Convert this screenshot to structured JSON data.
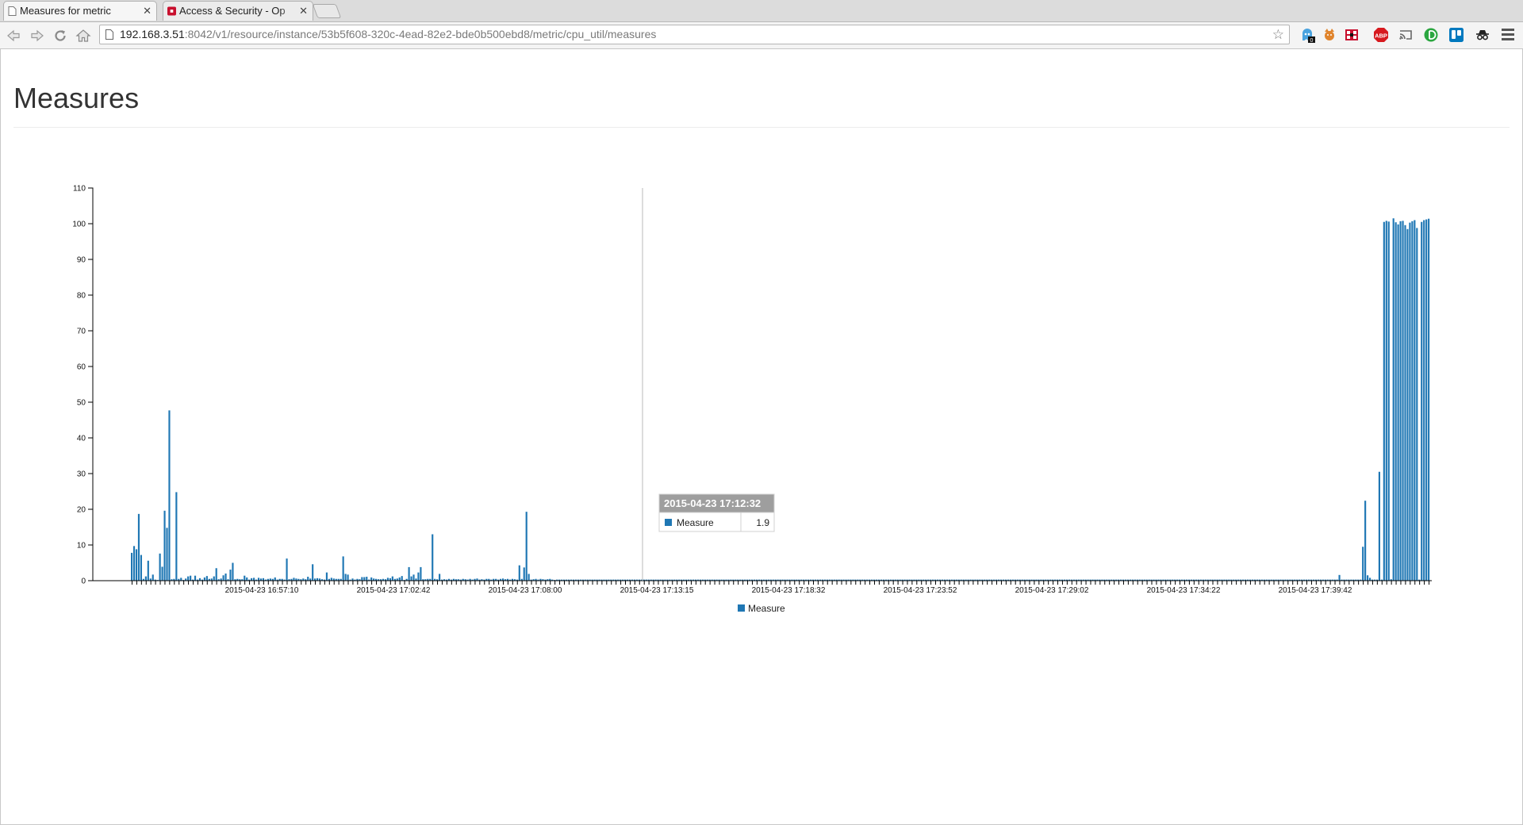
{
  "browser": {
    "tabs": [
      {
        "title": "Measures for metric",
        "active": true,
        "icon": "page-icon"
      },
      {
        "title": "Access & Security - Op",
        "active": false,
        "icon": "openstack-icon"
      }
    ],
    "url_host": "192.168.3.51",
    "url_rest": ":8042/v1/resource/instance/53b5f608-320c-4ead-82e2-bde0b500ebd8/metric/cpu_util/measures",
    "extensions": [
      "ghostery-icon",
      "fox-icon",
      "shield-icon",
      "adblock-plus-icon",
      "cast-icon",
      "ios-icon",
      "trello-icon",
      "incognito-icon"
    ],
    "ghostery_badge": "0",
    "abp_label": "ABP"
  },
  "page": {
    "title": "Measures"
  },
  "tooltip": {
    "time": "2015-04-23 17:12:32",
    "series": "Measure",
    "value": "1.9"
  },
  "chart_data": {
    "type": "bar",
    "title": "",
    "xlabel": "",
    "ylabel": "",
    "ylim": [
      0,
      110
    ],
    "yticks": [
      0,
      10,
      20,
      30,
      40,
      50,
      60,
      70,
      80,
      90,
      100,
      110
    ],
    "x_tick_labels": [
      "2015-04-23 16:57:10",
      "2015-04-23 17:02:42",
      "2015-04-23 17:08:00",
      "2015-04-23 17:13:15",
      "2015-04-23 17:18:32",
      "2015-04-23 17:23:52",
      "2015-04-23 17:29:02",
      "2015-04-23 17:34:22",
      "2015-04-23 17:39:42"
    ],
    "legend": [
      "Measure"
    ],
    "legend_position": "bottom",
    "bar_color": "#1f77b4",
    "series": [
      {
        "name": "Measure",
        "values": [
          7.8,
          9.7,
          8.8,
          18.7,
          7.2,
          0.5,
          1.2,
          5.6,
          0.6,
          1.7,
          0.3,
          0.2,
          7.6,
          3.9,
          19.6,
          14.8,
          47.7,
          0.4,
          0.5,
          24.8,
          0.5,
          0.8,
          0.2,
          0.6,
          1.2,
          1.4,
          0.3,
          1.4,
          0.3,
          0.7,
          0.3,
          0.9,
          1.3,
          0.5,
          0.6,
          1.2,
          3.5,
          0.4,
          0.6,
          1.5,
          2.0,
          0.4,
          3.1,
          5.0,
          0.4,
          0.5,
          0.4,
          0.4,
          1.4,
          0.9,
          0.3,
          0.7,
          0.8,
          0.3,
          0.8,
          0.6,
          0.7,
          0.3,
          0.5,
          0.6,
          0.5,
          0.9,
          0.3,
          0.5,
          0.5,
          0.3,
          6.2,
          0.4,
          0.5,
          0.8,
          0.6,
          0.5,
          0.4,
          0.6,
          0.4,
          1.1,
          0.6,
          4.6,
          0.6,
          0.7,
          0.6,
          0.4,
          0.3,
          2.3,
          0.5,
          0.8,
          0.6,
          0.5,
          0.5,
          0.5,
          6.8,
          1.9,
          1.7,
          0.3,
          0.6,
          0.3,
          0.5,
          0.4,
          1.0,
          1.0,
          1.1,
          0.3,
          0.9,
          0.6,
          0.5,
          0.4,
          0.4,
          0.5,
          0.4,
          0.8,
          0.7,
          1.2,
          0.5,
          0.6,
          0.9,
          1.3,
          0.2,
          0.5,
          3.8,
          1.2,
          1.7,
          0.6,
          2.3,
          3.8,
          0.4,
          0.4,
          0.5,
          0.5,
          13.0,
          0.5,
          0.4,
          1.9,
          0.3,
          0.4,
          0.3,
          0.5,
          0.3,
          0.5,
          0.4,
          0.4,
          0.3,
          0.5,
          0.4,
          0.3,
          0.5,
          0.3,
          0.5,
          0.6,
          0.3,
          0.4,
          0.3,
          0.5,
          0.5,
          0.3,
          0.5,
          0.5,
          0.3,
          0.5,
          0.6,
          0.4,
          0.5,
          0.3,
          0.5,
          0.4,
          0.3,
          4.3,
          0.5,
          3.7,
          19.3,
          1.9,
          0.3,
          0.4,
          0.5,
          0.3,
          0.5,
          0.4,
          0.3,
          0.4,
          0.5,
          0.3,
          0.2,
          0.3,
          0.3,
          0.3,
          0.3,
          0.3,
          0.3,
          0.3,
          0.3,
          0.3,
          0.3,
          0.3,
          0.3,
          0.3,
          0.3,
          0.3,
          0.3,
          0.3,
          0.3,
          0.3,
          0.3,
          0.3,
          0.3,
          0.3,
          0.3,
          0.3,
          0.3,
          0.3,
          0.3,
          0.3,
          0.3,
          0.3,
          0.3,
          0.3,
          0.3,
          0.3,
          0.3,
          0.3,
          0.3,
          0.3,
          0.3,
          0.3,
          0.3,
          0.3,
          0.3,
          0.3,
          0.3,
          0.3,
          0.3,
          0.3,
          0.3,
          0.3,
          0.3,
          0.3,
          0.3,
          0.3,
          0.3,
          0.3,
          0.3,
          0.3,
          0.3,
          0.3,
          0.3,
          0.3,
          0.3,
          0.3,
          0.3,
          0.3,
          0.3,
          0.3,
          0.3,
          0.3,
          0.3,
          0.3,
          0.3,
          0.3,
          0.3,
          0.3,
          0.3,
          0.3,
          0.3,
          0.3,
          0.3,
          0.3,
          0.3,
          0.3,
          0.3,
          0.3,
          0.3,
          0.3,
          0.3,
          0.3,
          0.3,
          0.3,
          0.3,
          0.3,
          0.3,
          0.3,
          0.3,
          0.3,
          0.3,
          0.3,
          0.3,
          0.3,
          0.3,
          0.3,
          0.3,
          0.3,
          0.3,
          0.3,
          0.3,
          0.3,
          0.3,
          0.3,
          0.3,
          0.3,
          0.3,
          0.3,
          0.3,
          0.3,
          0.3,
          0.3,
          0.3,
          0.3,
          0.3,
          0.3,
          0.3,
          0.3,
          0.3,
          0.3,
          0.3,
          0.3,
          0.3,
          0.3,
          0.3,
          0.3,
          0.3,
          0.3,
          0.3,
          0.3,
          0.3,
          0.3,
          0.3,
          0.3,
          0.3,
          0.3,
          0.3,
          0.3,
          0.3,
          0.3,
          0.3,
          0.3,
          0.3,
          0.3,
          0.3,
          0.3,
          0.3,
          0.3,
          0.3,
          0.3,
          0.3,
          0.3,
          0.3,
          0.3,
          0.3,
          0.3,
          0.3,
          0.3,
          0.3,
          0.3,
          0.3,
          0.3,
          0.3,
          0.3,
          0.3,
          0.3,
          0.3,
          0.3,
          0.3,
          0.3,
          0.3,
          0.3,
          0.3,
          0.3,
          0.3,
          0.3,
          0.3,
          0.3,
          0.3,
          0.3,
          0.3,
          0.3,
          0.3,
          0.3,
          0.3,
          0.3,
          0.3,
          0.3,
          0.3,
          0.3,
          0.3,
          0.3,
          0.3,
          0.3,
          0.3,
          0.3,
          0.3,
          0.3,
          0.3,
          0.3,
          0.3,
          0.3,
          0.3,
          0.3,
          0.3,
          0.3,
          0.3,
          0.3,
          0.3,
          0.3,
          0.3,
          0.3,
          0.3,
          0.3,
          0.3,
          0.3,
          0.3,
          0.3,
          0.3,
          0.3,
          0.3,
          0.3,
          0.3,
          0.3,
          0.3,
          0.3,
          0.3,
          0.3,
          0.3,
          0.3,
          0.3,
          0.3,
          0.3,
          0.3,
          0.3,
          0.3,
          0.3,
          0.3,
          0.3,
          0.3,
          0.3,
          0.3,
          0.3,
          0.3,
          0.3,
          0.3,
          0.3,
          0.3,
          0.3,
          0.3,
          0.3,
          0.3,
          0.3,
          0.3,
          0.3,
          0.3,
          0.3,
          0.3,
          0.3,
          0.3,
          0.3,
          0.3,
          0.3,
          0.3,
          0.3,
          0.3,
          0.3,
          0.3,
          0.3,
          0.3,
          0.3,
          0.3,
          0.3,
          0.3,
          0.3,
          0.3,
          0.3,
          0.3,
          0.3,
          0.3,
          0.3,
          0.3,
          0.3,
          0.3,
          0.3,
          0.3,
          0.3,
          0.3,
          0.3,
          0.3,
          0.3,
          0.3,
          0.3,
          0.3,
          0.3,
          0.3,
          0.3,
          0.3,
          0.3,
          0.3,
          0.3,
          0.3,
          0.3,
          0.3,
          0.3,
          0.3,
          0.3,
          0.3,
          0.3,
          0.3,
          0.3,
          0.3,
          0.3,
          0.3,
          0.3,
          0.3,
          0.3,
          0.3,
          0.3,
          0.3,
          0.3,
          0.3,
          0.3,
          0.3,
          1.6,
          0.3,
          0.3,
          0.3,
          0.3,
          0.3,
          0.3,
          0.3,
          0.3,
          0.3,
          9.5,
          22.4,
          1.5,
          0.8,
          0.3,
          0.3,
          0.3,
          30.5,
          0.3,
          100.5,
          100.8,
          100.6,
          0.4,
          101.5,
          100.4,
          99.8,
          100.7,
          100.8,
          99.6,
          98.5,
          100.3,
          100.7,
          101.0,
          98.8,
          0.3,
          100.5,
          101.0,
          101.2,
          101.4
        ]
      }
    ]
  }
}
